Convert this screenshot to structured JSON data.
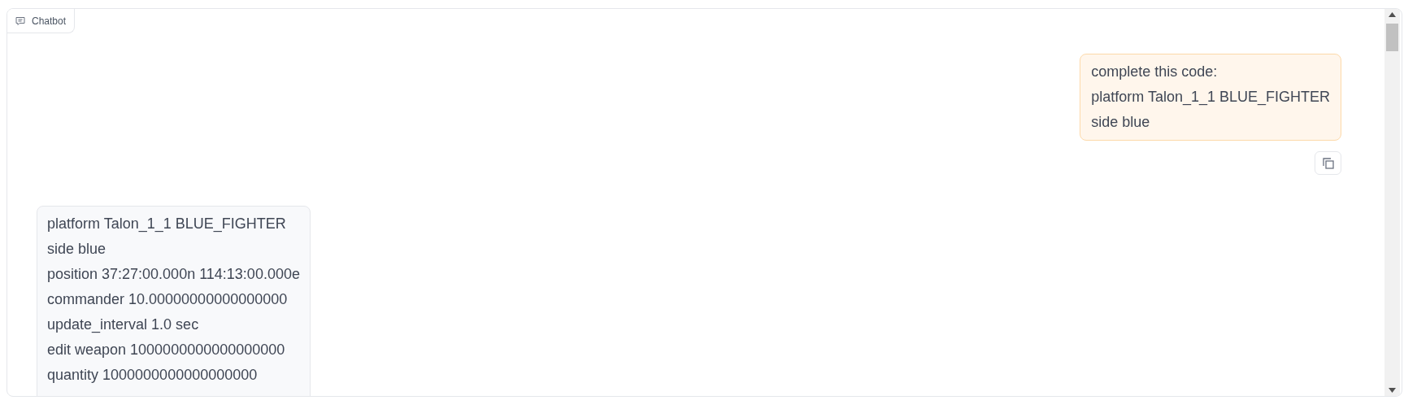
{
  "panel": {
    "label": "Chatbot"
  },
  "messages": [
    {
      "kind": "user",
      "lines": [
        "complete this code:",
        "platform Talon_1_1 BLUE_FIGHTER",
        "side blue"
      ],
      "copy_button": true
    },
    {
      "kind": "bot",
      "lines": [
        "platform Talon_1_1 BLUE_FIGHTER",
        "side blue",
        "position 37:27:00.000n 114:13:00.000e",
        "commander 10.00000000000000000",
        "update_interval 1.0 sec",
        "edit weapon 1000000000000000000",
        "quantity 1000000000000000000"
      ],
      "copy_button": false
    }
  ]
}
